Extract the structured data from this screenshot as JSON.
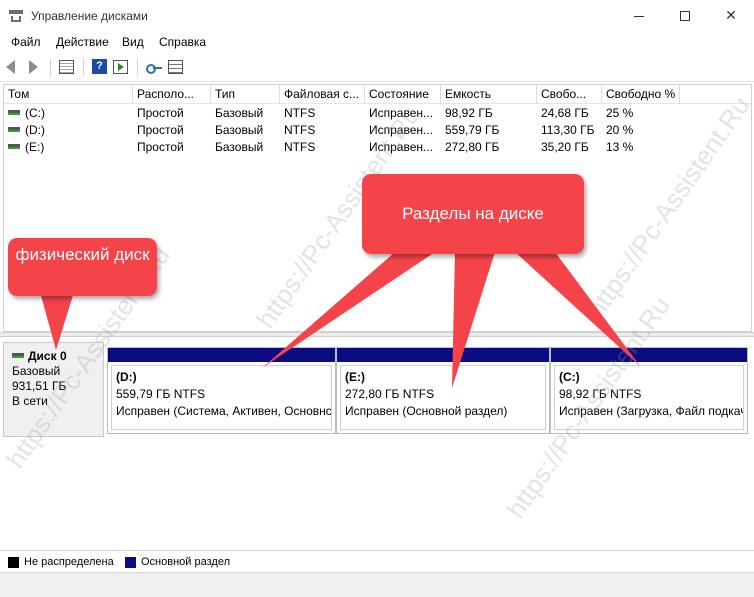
{
  "window": {
    "title": "Управление дисками"
  },
  "menu": [
    "Файл",
    "Действие",
    "Вид",
    "Справка"
  ],
  "volumes": {
    "columns": [
      "Том",
      "Располо...",
      "Тип",
      "Файловая с...",
      "Состояние",
      "Емкость",
      "Свобо...",
      "Свободно %"
    ],
    "rows": [
      {
        "name": "(C:)",
        "layout": "Простой",
        "type": "Базовый",
        "fs": "NTFS",
        "status": "Исправен...",
        "capacity": "98,92 ГБ",
        "free": "24,68 ГБ",
        "free_pct": "25 %"
      },
      {
        "name": "(D:)",
        "layout": "Простой",
        "type": "Базовый",
        "fs": "NTFS",
        "status": "Исправен...",
        "capacity": "559,79 ГБ",
        "free": "113,30 ГБ",
        "free_pct": "20 %"
      },
      {
        "name": "(E:)",
        "layout": "Простой",
        "type": "Базовый",
        "fs": "NTFS",
        "status": "Исправен...",
        "capacity": "272,80 ГБ",
        "free": "35,20 ГБ",
        "free_pct": "13 %"
      }
    ]
  },
  "disk": {
    "name": "Диск 0",
    "type": "Базовый",
    "size": "931,51 ГБ",
    "state": "В сети"
  },
  "partitions": [
    {
      "name": "(D:)",
      "size": "559,79 ГБ NTFS",
      "status": "Исправен (Система, Активен, Основнс"
    },
    {
      "name": "(E:)",
      "size": "272,80 ГБ NTFS",
      "status": "Исправен (Основной раздел)"
    },
    {
      "name": "(C:)",
      "size": "98,92 ГБ NTFS",
      "status": "Исправен (Загрузка, Файл подкач"
    }
  ],
  "legend": {
    "unallocated": "Не распределена",
    "primary": "Основной раздел",
    "unallocated_color": "#000000",
    "primary_color": "#0a0a82"
  },
  "callouts": {
    "physical_disk": "физический диск",
    "partitions": "Разделы на диске",
    "color": "#f4444a"
  },
  "watermark": "https://Pc-Assistent.Ru"
}
